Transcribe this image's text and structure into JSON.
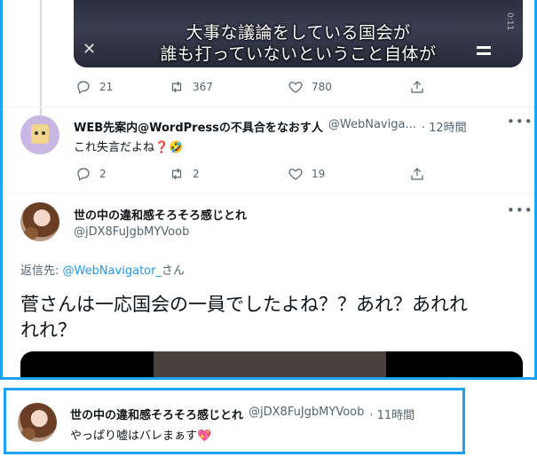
{
  "video": {
    "subtitle_line1": "大事な議論をしている国会が",
    "subtitle_line2": "誰も打っていないということ自体が",
    "side_label": "0:11"
  },
  "tweet1_actions": {
    "replies": "21",
    "retweets": "367",
    "likes": "780"
  },
  "reply1": {
    "name": "WEB先案内@WordPressの不具合をなおす人",
    "handle": "@WebNaviga...",
    "dot_time": "· 12時間",
    "text": "これ失言だよね❓🤣",
    "replies": "2",
    "retweets": "2",
    "likes": "19"
  },
  "main_tweet": {
    "name": "世の中の違和感そろそろ感じとれ",
    "handle": "@jDX8FuJgbMYVoob",
    "reply_prefix": "返信先: ",
    "reply_to": "@WebNavigator_",
    "reply_suffix": "さん",
    "text_line1": "菅さんは一応国会の一員でしたよね？？あれ？あれれ",
    "text_line2": "れれ？"
  },
  "bottom_reply": {
    "name": "世の中の違和感そろそろ感じとれ",
    "handle": "@jDX8FuJgbMYVoob",
    "dot_time": "· 11時間",
    "text": "やっぱり嘘はバレまぁす💖"
  },
  "colors": {
    "frame": "#1da1f2",
    "link": "#1d9bf0",
    "secondary_text": "#536471"
  }
}
